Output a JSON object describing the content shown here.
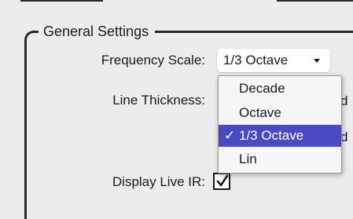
{
  "group": {
    "title": "General Settings"
  },
  "settings": {
    "frequency_scale": {
      "label": "Frequency Scale:",
      "value": "1/3 Octave",
      "options": [
        "Decade",
        "Octave",
        "1/3 Octave",
        "Lin"
      ]
    },
    "line_thickness": {
      "label": "Line Thickness:",
      "trailing": "d"
    },
    "hidden_row": {
      "trailing": "d"
    },
    "display_live_ir": {
      "label": "Display Live IR:",
      "checked": true
    }
  },
  "dropdown": {
    "items": [
      {
        "label": "Decade",
        "selected": false
      },
      {
        "label": "Octave",
        "selected": false
      },
      {
        "label": "1/3 Octave",
        "selected": true
      },
      {
        "label": "Lin",
        "selected": false
      }
    ],
    "check_glyph": "✓",
    "highlight_color": "#4a49c2"
  },
  "icons": {
    "select_arrow": "chevron-down-icon",
    "checkbox_mark": "checkmark-icon"
  }
}
